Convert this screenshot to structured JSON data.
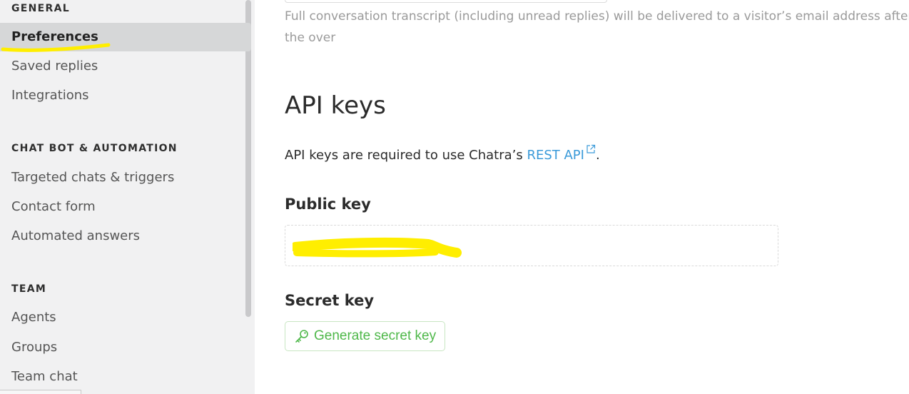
{
  "sidebar": {
    "sections": [
      {
        "title": "GENERAL",
        "items": [
          "Preferences",
          "Saved replies",
          "Integrations"
        ]
      },
      {
        "title": "CHAT BOT & AUTOMATION",
        "items": [
          "Targeted chats & triggers",
          "Contact form",
          "Automated answers"
        ]
      },
      {
        "title": "TEAM",
        "items": [
          "Agents",
          "Groups",
          "Team chat"
        ]
      }
    ],
    "active_item": "Preferences",
    "highlight_color": "#ffee00"
  },
  "main": {
    "transcript_note": "Full conversation transcript (including unread replies) will be delivered to a visitor’s email address after the over",
    "api_heading": "API keys",
    "api_desc_prefix": "API keys are required to use Chatra’s ",
    "api_desc_link": "REST API",
    "api_desc_suffix": ".",
    "public_key_label": "Public key",
    "public_key_value_redacted": true,
    "secret_key_label": "Secret key",
    "generate_button_label": "Generate secret key"
  },
  "colors": {
    "sidebar_bg": "#f1f1f2",
    "link": "#3a9ad9",
    "button_green": "#4fb84a",
    "redaction_yellow": "#ffee00"
  }
}
